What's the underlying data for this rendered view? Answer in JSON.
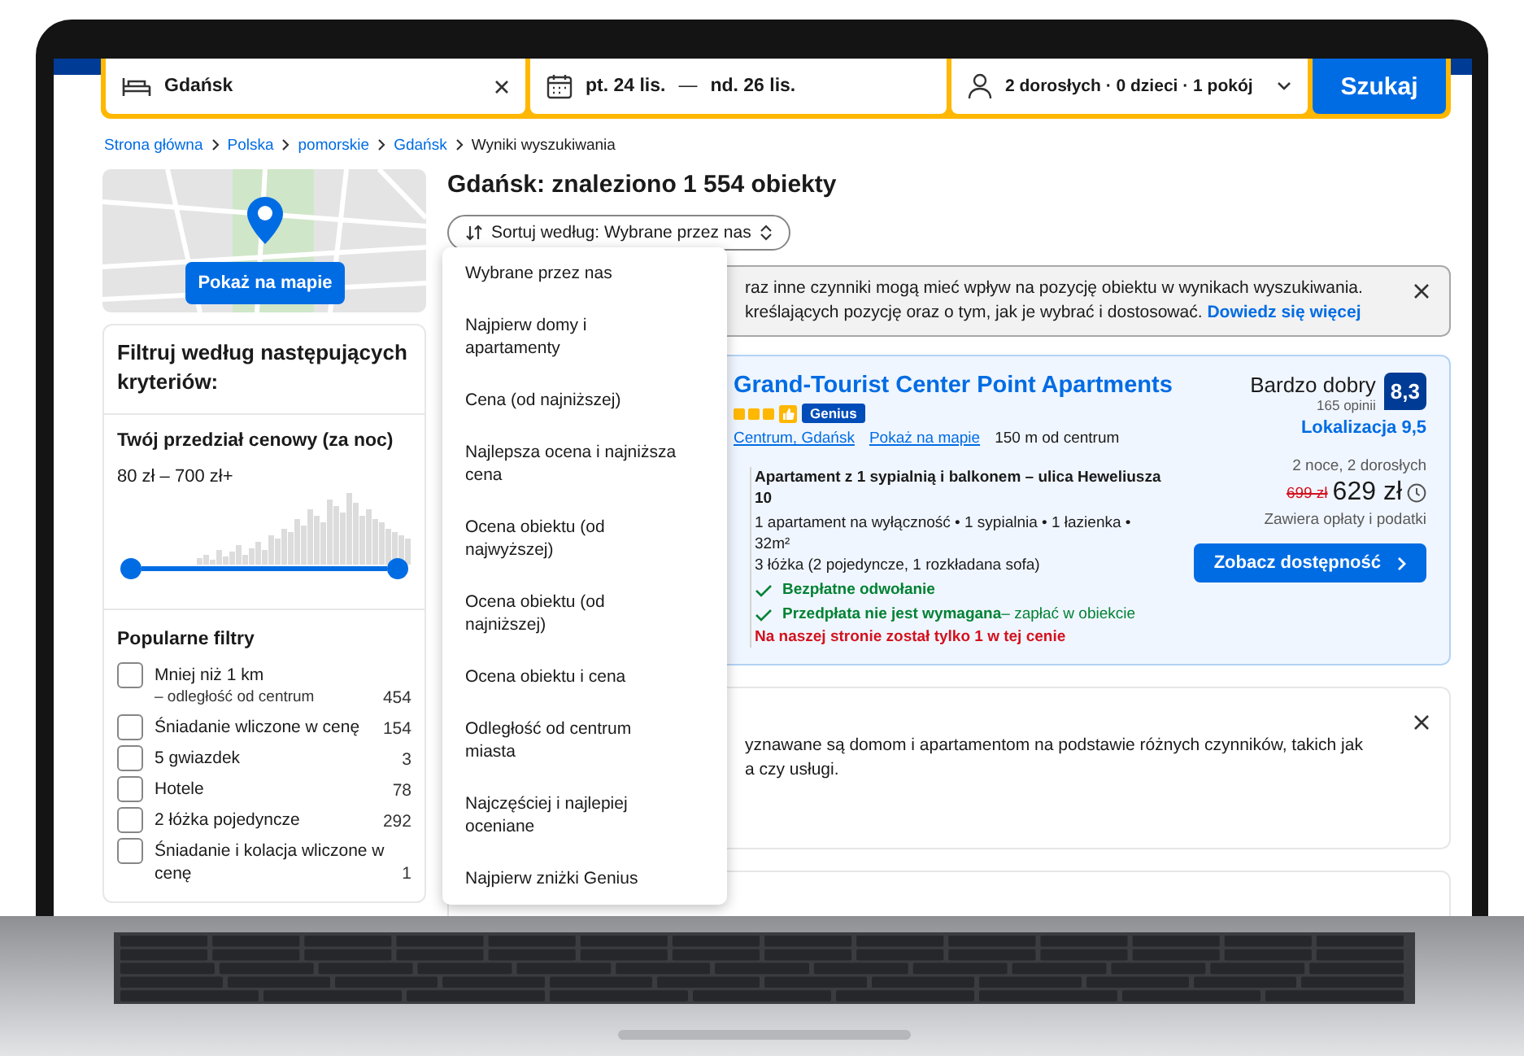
{
  "search": {
    "destination": "Gdańsk",
    "dates": {
      "from": "pt. 24 lis.",
      "separator": "—",
      "to": "nd. 26 lis."
    },
    "guests": "2 dorosłych · 0 dzieci · 1 pokój",
    "button": "Szukaj"
  },
  "breadcrumbs": [
    {
      "label": "Strona główna",
      "link": true
    },
    {
      "label": "Polska",
      "link": true
    },
    {
      "label": "pomorskie",
      "link": true
    },
    {
      "label": "Gdańsk",
      "link": true
    },
    {
      "label": "Wyniki wyszukiwania",
      "link": false
    }
  ],
  "map": {
    "button": "Pokaż na mapie"
  },
  "filters": {
    "title": "Filtruj według następujących kryteriów:",
    "price": {
      "title": "Twój przedział cenowy (za noc)",
      "range": "80 zł – 700 zł+",
      "level": 1
    },
    "popular_title": "Popularne filtry",
    "items": [
      {
        "label": "Mniej niż 1 km",
        "sublabel": "– odległość od centrum",
        "count": "454",
        "checked": false
      },
      {
        "label": "Śniadanie wliczone w cenę",
        "count": "154",
        "checked": false
      },
      {
        "label": "5 gwiazdek",
        "count": "3",
        "checked": false
      },
      {
        "label": "Hotele",
        "count": "78",
        "checked": false
      },
      {
        "label": "2 łóżka pojedyncze",
        "count": "292",
        "checked": false
      },
      {
        "label": "Śniadanie i kolacja wliczone w cenę",
        "count": "1",
        "checked": false
      }
    ]
  },
  "results": {
    "heading": "Gdańsk: znaleziono 1 554 obiekty",
    "sort": {
      "label": "Sortuj według: Wybrane przez nas",
      "expanded": true,
      "options": [
        "Wybrane przez nas",
        "Najpierw domy i apartamenty",
        "Cena (od najniższej)",
        "Najlepsza ocena i najniższa cena",
        "Ocena obiektu (od najwyższej)",
        "Ocena obiektu (od najniższej)",
        "Ocena obiektu i cena",
        "Odległość od centrum miasta",
        "Najczęściej i najlepiej oceniane",
        "Najpierw zniżki Genius"
      ]
    },
    "notice": {
      "lines": [
        "raz inne czynniki mogą mieć wpływ na pozycję obiektu w wynikach wyszukiwania.",
        "kreślających pozycję oraz o tym, jak je wybrać i dostosować."
      ],
      "link": "Dowiedz się więcej"
    },
    "property": {
      "name": "Grand-Tourist Center Point Apartments",
      "stars": 3,
      "badge": "Genius",
      "area": "Centrum, Gdańsk",
      "map_link": "Pokaż na mapie",
      "distance": "150 m od centrum",
      "rating_word": "Bardzo dobry",
      "reviews": "165 opinii",
      "score": "8,3",
      "location_score": "Lokalizacja 9,5",
      "room": "Apartament z 1 sypialnią i balkonem – ulica Heweliusza 10",
      "details": "1 apartament na wyłączność • 1 sypialnia • 1 łazienka • 32m²",
      "beds": "3 łóżka (2 pojedyncze, 1 rozkładana sofa)",
      "perks": [
        {
          "text": "Bezpłatne odwołanie"
        },
        {
          "text": "Przedpłata nie jest wymagana",
          "note": "– zapłać w obiekcie"
        }
      ],
      "scarcity": "Na naszej stronie został tylko 1 w tej cenie",
      "stay": "2 noce, 2 dorosłych",
      "old_price": "699 zł",
      "price": "629 zł",
      "taxes": "Zawiera opłaty i podatki",
      "button": "Zobacz dostępność"
    },
    "notice2": {
      "lines": [
        "yznawane są domom i apartamentom na podstawie różnych czynników, takich jak",
        "a czy usługi."
      ]
    }
  }
}
